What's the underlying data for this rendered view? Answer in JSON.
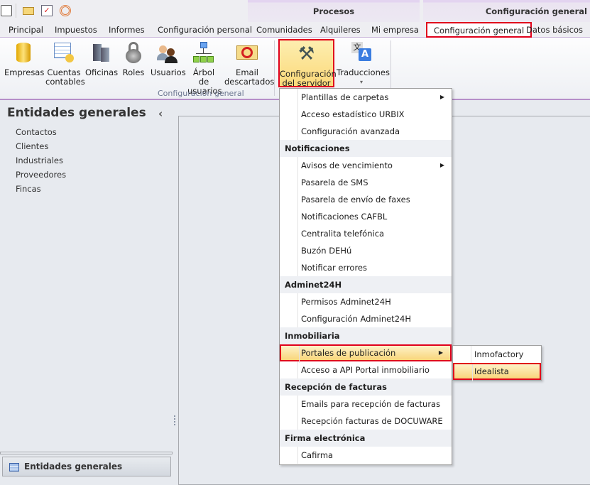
{
  "quick_access": {
    "icons": [
      "app-menu-icon",
      "mail-icon",
      "task-icon",
      "broadcast-icon"
    ]
  },
  "context_groups": {
    "procesos": "Procesos",
    "config": "Configuración general"
  },
  "tabs": [
    "Principal",
    "Impuestos",
    "Informes",
    "Configuración personal",
    "Comunidades",
    "Alquileres",
    "Mi empresa",
    "Configuración general",
    "Datos básicos"
  ],
  "selected_tab": "Configuración general",
  "ribbon": {
    "buttons": [
      {
        "l1": "Empresas",
        "l2": ""
      },
      {
        "l1": "Cuentas",
        "l2": "contables"
      },
      {
        "l1": "Oficinas",
        "l2": ""
      },
      {
        "l1": "Roles",
        "l2": ""
      },
      {
        "l1": "Usuarios",
        "l2": ""
      },
      {
        "l1": "Árbol de",
        "l2": "usuarios"
      },
      {
        "l1": "Email",
        "l2": "descartados"
      },
      {
        "l1": "Configuración",
        "l2": "del servidor ▾"
      },
      {
        "l1": "Traducciones",
        "l2": "▾"
      }
    ],
    "group_label": "Configuración general"
  },
  "left_panel": {
    "title": "Entidades generales",
    "items": [
      "Contactos",
      "Clientes",
      "Industriales",
      "Proveedores",
      "Fincas"
    ],
    "collapse": "‹",
    "nav_button": "Entidades generales"
  },
  "menu": [
    {
      "type": "item",
      "label": "Plantillas de carpetas",
      "sub": true
    },
    {
      "type": "item",
      "label": "Acceso estadístico URBIX"
    },
    {
      "type": "item",
      "label": "Configuración avanzada"
    },
    {
      "type": "head",
      "label": "Notificaciones"
    },
    {
      "type": "item",
      "label": "Avisos de vencimiento",
      "sub": true
    },
    {
      "type": "item",
      "label": "Pasarela de SMS"
    },
    {
      "type": "item",
      "label": "Pasarela de envío de faxes"
    },
    {
      "type": "item",
      "label": "Notificaciones CAFBL"
    },
    {
      "type": "item",
      "label": "Centralita telefónica"
    },
    {
      "type": "item",
      "label": "Buzón DEHú"
    },
    {
      "type": "item",
      "label": "Notificar errores"
    },
    {
      "type": "head",
      "label": "Adminet24H"
    },
    {
      "type": "item",
      "label": "Permisos Adminet24H"
    },
    {
      "type": "item",
      "label": "Configuración Adminet24H"
    },
    {
      "type": "head",
      "label": "Inmobiliaria"
    },
    {
      "type": "item",
      "label": "Portales de publicación",
      "sub": true,
      "hl": true
    },
    {
      "type": "item",
      "label": "Acceso a API Portal inmobiliario"
    },
    {
      "type": "head",
      "label": "Recepción de facturas"
    },
    {
      "type": "item",
      "label": "Emails para recepción de facturas"
    },
    {
      "type": "item",
      "label": "Recepción facturas de DOCUWARE"
    },
    {
      "type": "head",
      "label": "Firma electrónica"
    },
    {
      "type": "item",
      "label": "Cafirma"
    }
  ],
  "submenu": [
    {
      "label": "Inmofactory"
    },
    {
      "label": "Idealista",
      "hl": true
    }
  ]
}
